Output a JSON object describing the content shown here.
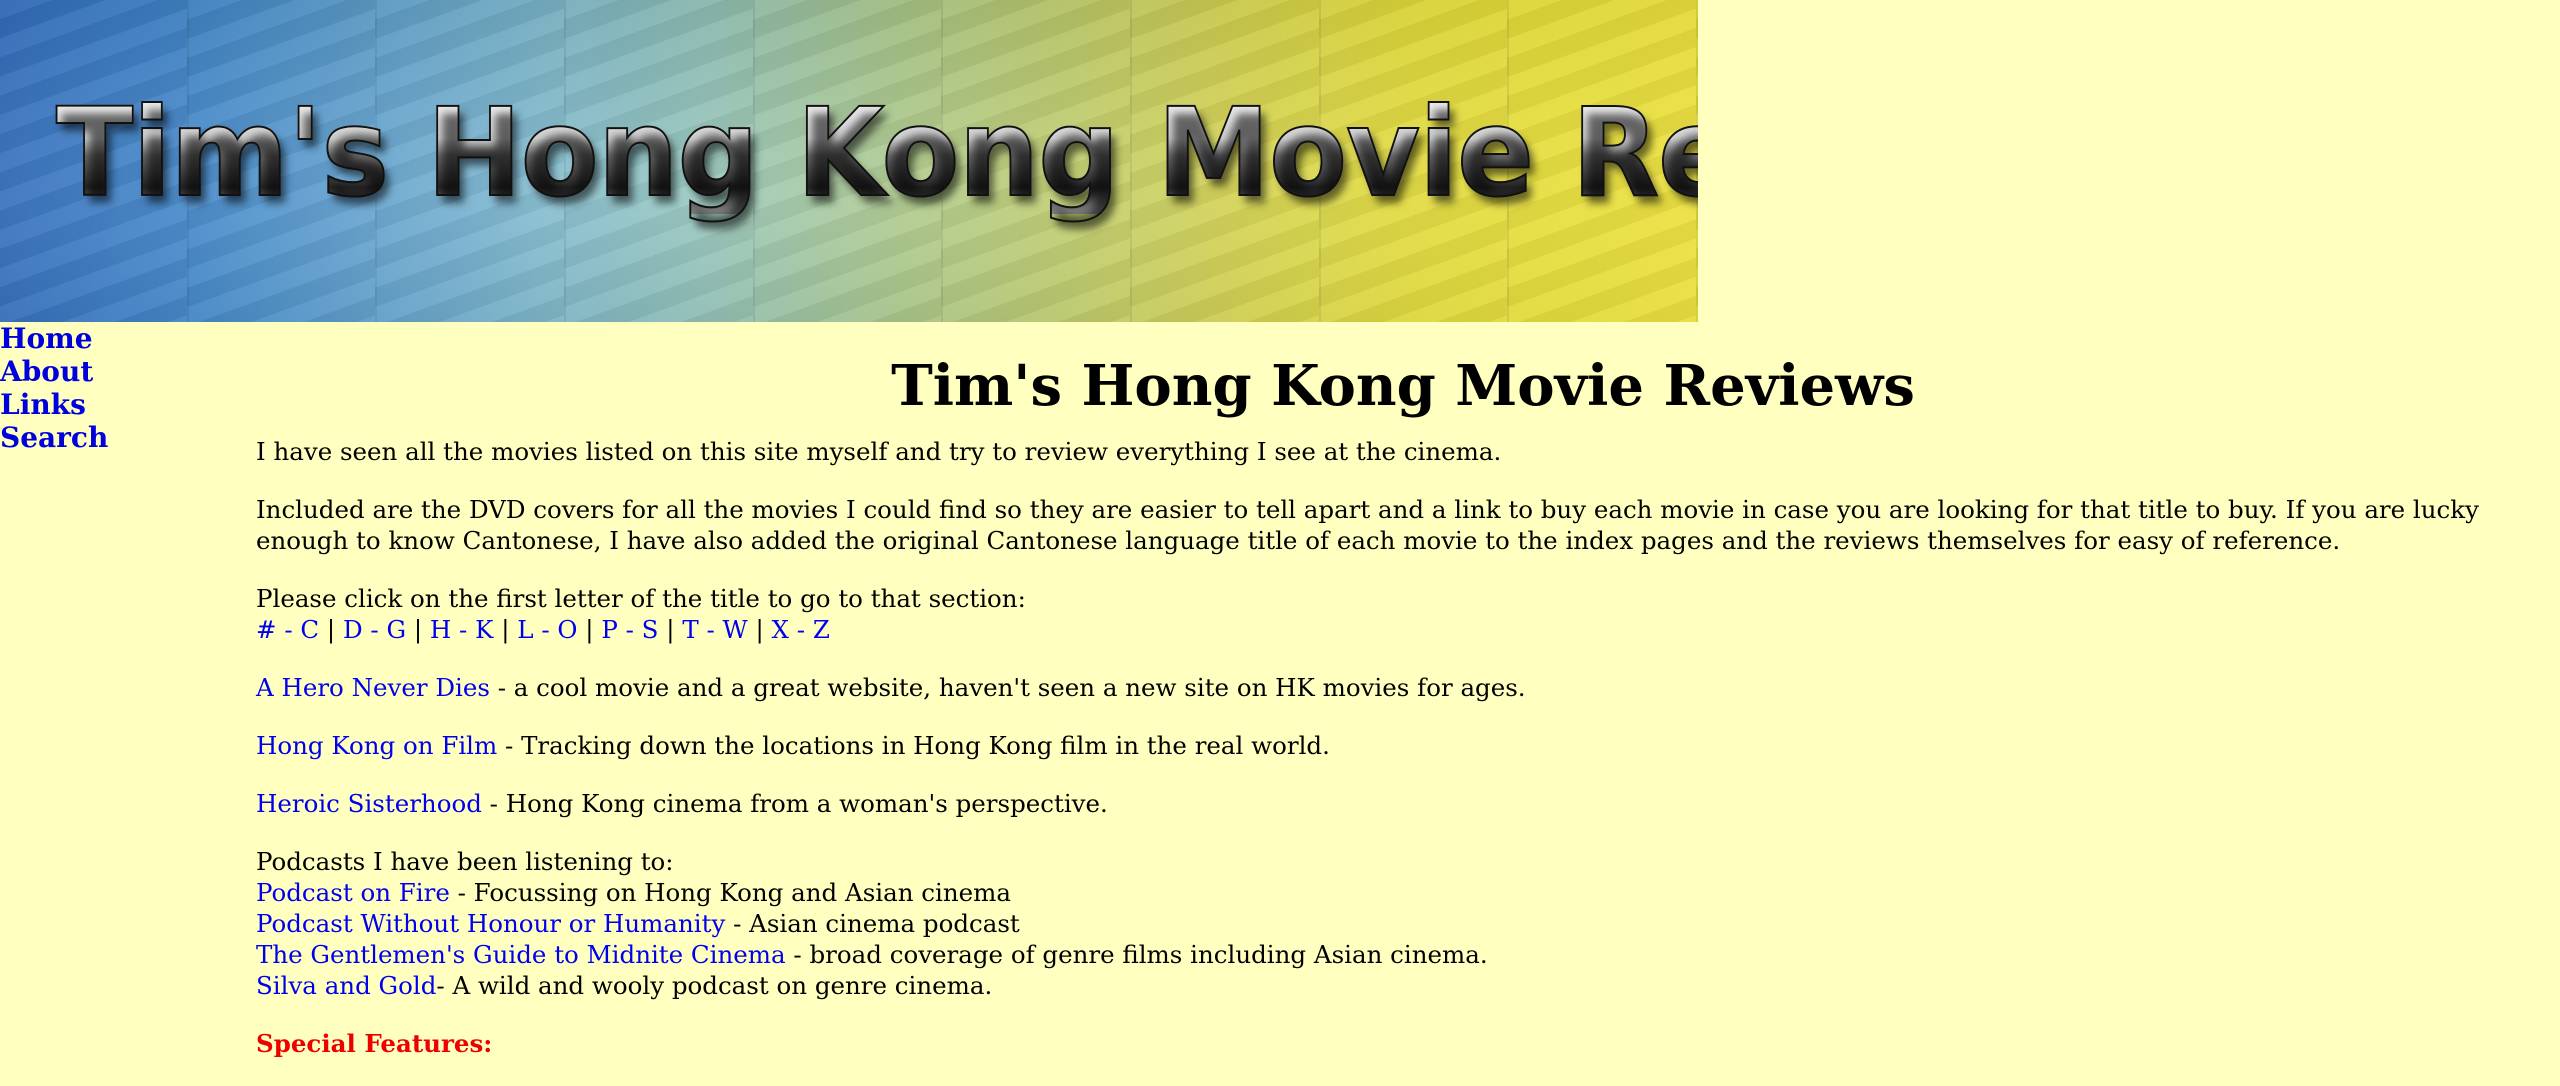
{
  "banner": {
    "title": "Tim's Hong Kong Movie Reviews"
  },
  "nav": {
    "items": [
      {
        "label": "Home"
      },
      {
        "label": "About"
      },
      {
        "label": "Links"
      },
      {
        "label": "Search"
      }
    ]
  },
  "main": {
    "title": "Tim's Hong Kong Movie Reviews",
    "intro": "I have seen all the movies listed on this site myself and try to review everything I see at the cinema.",
    "dvd_text": "Included are the DVD covers for all the movies I could find so they are easier to tell apart and a link to buy each movie in case you are looking for that title to buy. If you are lucky enough to know Cantonese, I have also added the original Cantonese language title of each movie to the index pages and the reviews themselves for easy of reference.",
    "letter_prompt": "Please click on the first letter of the title to go to that section:",
    "letters": [
      "# - C",
      "D - G",
      "H - K",
      "L - O",
      "P - S",
      "T - W",
      "X - Z"
    ],
    "separator": " | ",
    "links": [
      {
        "label": "A Hero Never Dies",
        "desc": " - a cool movie and a great website, haven't seen a new site on HK movies for ages."
      },
      {
        "label": "Hong Kong on Film",
        "desc": " - Tracking down the locations in Hong Kong film in the real world."
      },
      {
        "label": "Heroic Sisterhood",
        "desc": " - Hong Kong cinema from a woman's perspective."
      }
    ],
    "podcasts_heading": "Podcasts I have been listening to:",
    "podcasts": [
      {
        "label": "Podcast on Fire",
        "desc": " - Focussing on Hong Kong and Asian cinema"
      },
      {
        "label": "Podcast Without Honour or Humanity",
        "desc": " - Asian cinema podcast"
      },
      {
        "label": "The Gentlemen's Guide to Midnite Cinema",
        "desc": " - broad coverage of genre films including Asian cinema."
      },
      {
        "label": "Silva and Gold",
        "desc": "- A wild and wooly podcast on genre cinema."
      }
    ],
    "special_features": "Special Features:"
  },
  "colors": {
    "background": "#ffffc0",
    "link": "#0000ee",
    "special": "#ee0000"
  }
}
